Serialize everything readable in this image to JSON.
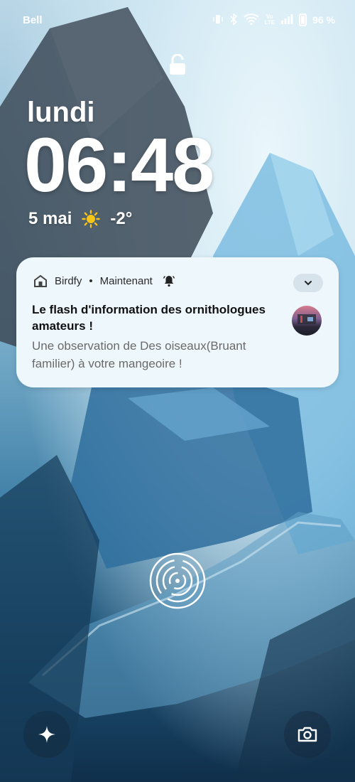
{
  "status_bar": {
    "carrier": "Bell",
    "battery_percent": "96 %",
    "icons": [
      "vibrate-icon",
      "bluetooth-icon",
      "wifi-icon",
      "volte-icon",
      "signal-icon",
      "battery-icon"
    ]
  },
  "lockscreen": {
    "day": "lundi",
    "time": "06:48",
    "date": "5 mai",
    "temperature": "-2°",
    "weather_icon": "sun-icon"
  },
  "notification": {
    "app_name": "Birdfy",
    "separator": "•",
    "time": "Maintenant",
    "title": "Le flash d'information des ornithologues amateurs !",
    "text": "Une observation de Des oiseaux(Bruant familier) à votre mangeoire !"
  },
  "colors": {
    "notification_bg": "#eef7fc",
    "text_primary": "#111111",
    "text_secondary": "#6a6a6a"
  }
}
